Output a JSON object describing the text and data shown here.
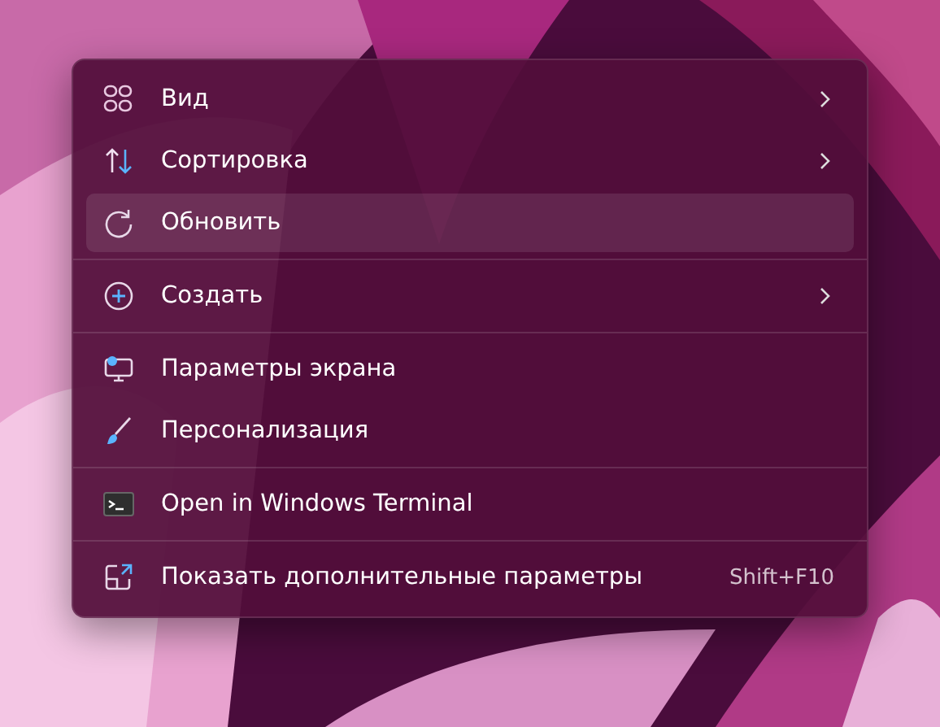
{
  "context_menu": {
    "groups": [
      {
        "items": [
          {
            "label": "Вид",
            "submenu": true,
            "selected": false
          },
          {
            "label": "Сортировка",
            "submenu": true,
            "selected": false
          },
          {
            "label": "Обновить",
            "submenu": false,
            "selected": true
          }
        ]
      },
      {
        "items": [
          {
            "label": "Создать",
            "submenu": true,
            "selected": false
          }
        ]
      },
      {
        "items": [
          {
            "label": "Параметры экрана",
            "submenu": false,
            "selected": false
          },
          {
            "label": "Персонализация",
            "submenu": false,
            "selected": false
          }
        ]
      },
      {
        "items": [
          {
            "label": "Open in Windows Terminal",
            "submenu": false,
            "selected": false
          }
        ]
      },
      {
        "items": [
          {
            "label": "Показать дополнительные параметры",
            "submenu": false,
            "selected": false,
            "shortcut": "Shift+F10"
          }
        ]
      }
    ]
  }
}
